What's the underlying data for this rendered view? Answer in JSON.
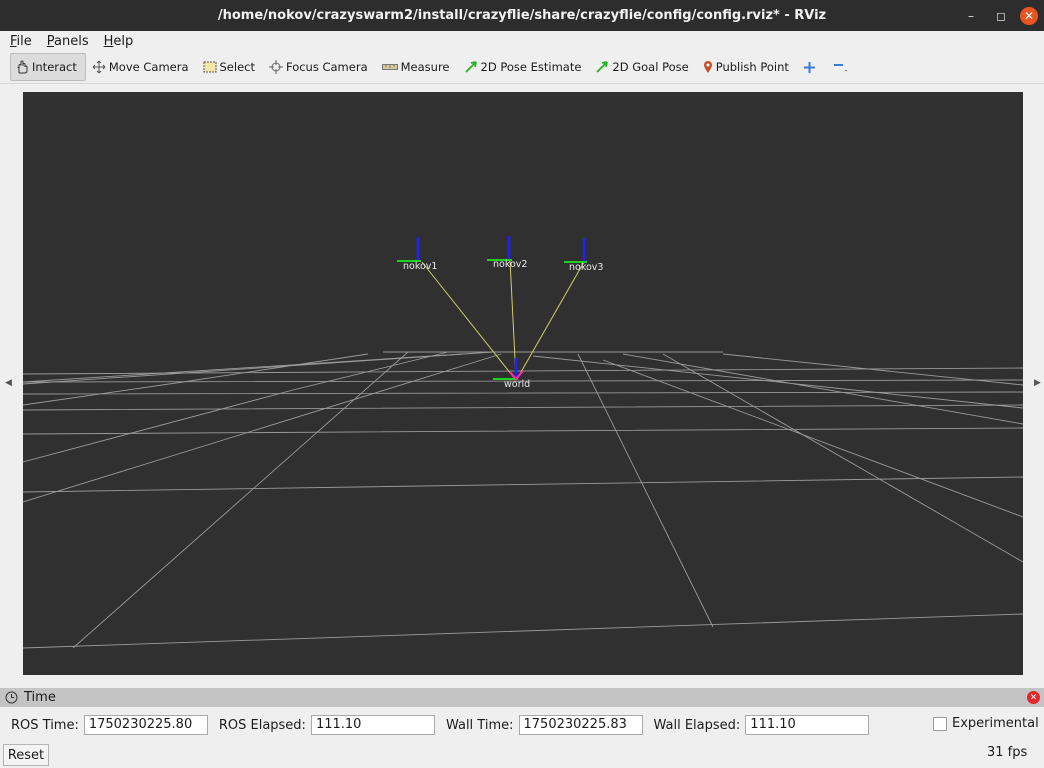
{
  "window": {
    "title": "/home/nokov/crazyswarm2/install/crazyflie/share/crazyflie/config/config.rviz* - RViz",
    "minimize": "–",
    "maximize": "◻",
    "close": "✕"
  },
  "menu": {
    "file": "File",
    "panels": "Panels",
    "help": "Help"
  },
  "toolbar": {
    "interact": "Interact",
    "move_camera": "Move Camera",
    "select": "Select",
    "focus_camera": "Focus Camera",
    "measure": "Measure",
    "pose_estimate": "2D Pose Estimate",
    "goal_pose": "2D Goal Pose",
    "publish_point": "Publish Point"
  },
  "scene": {
    "frames": [
      "nokov1",
      "nokov2",
      "nokov3",
      "world"
    ],
    "colors": {
      "background": "#303030",
      "grid": "#a0a0a0",
      "link": "#d4d46a",
      "x_axis": "#ff2020",
      "y_axis": "#20d020",
      "z_axis": "#2020ff"
    }
  },
  "time_panel": {
    "title": "Time",
    "ros_time_label": "ROS Time:",
    "ros_time": "1750230225.80",
    "ros_elapsed_label": "ROS Elapsed:",
    "ros_elapsed": "111.10",
    "wall_time_label": "Wall Time:",
    "wall_time": "1750230225.83",
    "wall_elapsed_label": "Wall Elapsed:",
    "wall_elapsed": "111.10",
    "experimental": "Experimental",
    "reset": "Reset",
    "fps": "31 fps"
  }
}
